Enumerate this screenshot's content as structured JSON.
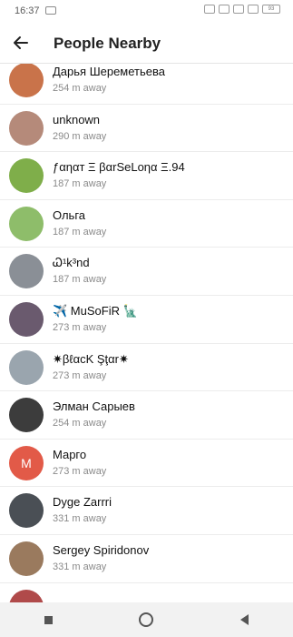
{
  "status_bar": {
    "time": "16:37",
    "battery": "93"
  },
  "header": {
    "title": "People Nearby"
  },
  "people": [
    {
      "name": "Дарья Шереметьева",
      "distance": "254 m away",
      "avatar_color": "#c9734a"
    },
    {
      "name": "unknown",
      "distance": "290 m away",
      "avatar_color": "#b58a7a"
    },
    {
      "name": "ƒαηαт Ξ βαrSeLoηα Ξ.94",
      "distance": "187 m away",
      "avatar_color": "#7fae4a"
    },
    {
      "name": "Ольга",
      "distance": "187 m away",
      "avatar_color": "#8ebd6a"
    },
    {
      "name": "Ꮗ¹k³nd",
      "distance": "187 m away",
      "avatar_color": "#8a8f96"
    },
    {
      "name": "✈️ MuSoFiR 🗽",
      "distance": "273 m away",
      "avatar_color": "#6a5a6e"
    },
    {
      "name": "✷βℓαcK Şţαr✷",
      "distance": "273 m away",
      "avatar_color": "#9aa5ae"
    },
    {
      "name": "Элман Сарыев",
      "distance": "254 m away",
      "avatar_color": "#3c3c3c"
    },
    {
      "name": "Марго",
      "distance": "273 m away",
      "avatar_color": "#e25a48",
      "letter": "M"
    },
    {
      "name": "Dyge Zarrri",
      "distance": "331 m away",
      "avatar_color": "#4a4f55"
    },
    {
      "name": "Sergey Spiridonov",
      "distance": "331 m away",
      "avatar_color": "#9a7a5e"
    },
    {
      "name": "",
      "distance": "",
      "avatar_color": "#b04a4a"
    }
  ]
}
